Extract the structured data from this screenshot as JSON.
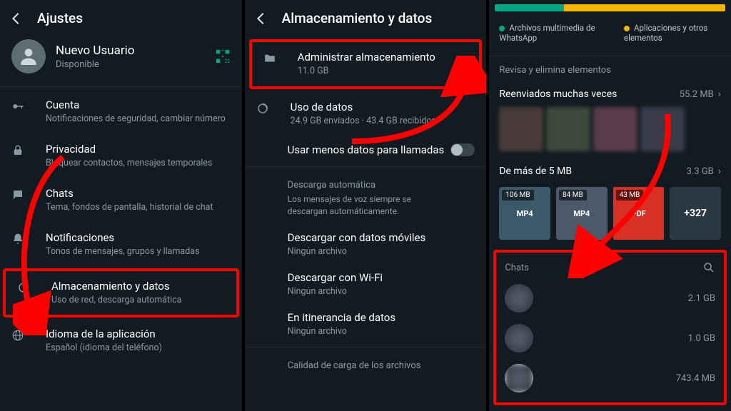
{
  "panel1": {
    "title": "Ajustes",
    "user": {
      "name": "Nuevo Usuario",
      "status": "Disponible"
    },
    "items": [
      {
        "label": "Cuenta",
        "sub": "Notificaciones de seguridad, cambiar número"
      },
      {
        "label": "Privacidad",
        "sub": "Bloquear contactos, mensajes temporales"
      },
      {
        "label": "Chats",
        "sub": "Tema, fondos de pantalla, historial de chat"
      },
      {
        "label": "Notificaciones",
        "sub": "Tonos de mensajes, grupos y llamadas"
      },
      {
        "label": "Almacenamiento y datos",
        "sub": "Uso de red, descarga automática"
      },
      {
        "label": "Idioma de la aplicación",
        "sub": "Español (idioma del teléfono)"
      }
    ]
  },
  "panel2": {
    "title": "Almacenamiento y datos",
    "manage": {
      "label": "Administrar almacenamiento",
      "sub": "11.0 GB"
    },
    "netuse": {
      "label": "Uso de datos",
      "sub": "24.9 GB enviados · 43.4 GB recibidos"
    },
    "lessdata": {
      "label": "Usar menos datos para llamadas"
    },
    "section_auto": "Descarga automática",
    "section_auto_sub": "Los mensajes de voz siempre se descargan automáticamente.",
    "dl": [
      {
        "label": "Descargar con datos móviles",
        "sub": "Ningún archivo"
      },
      {
        "label": "Descargar con Wi-Fi",
        "sub": "Ningún archivo"
      },
      {
        "label": "En itinerancia de datos",
        "sub": "Ningún archivo"
      }
    ],
    "quality_section": "Calidad de carga de los archivos"
  },
  "panel3": {
    "legend_media": "Archivos multimedia de WhatsApp",
    "legend_apps": "Aplicaciones y otros elementos",
    "review": "Revisa y elimina elementos",
    "forwarded": {
      "label": "Reenviados muchas veces",
      "size": "55.2 MB"
    },
    "over5": {
      "label": "De más de 5 MB",
      "size": "3.3 GB"
    },
    "tiles": [
      {
        "badge": "106 MB",
        "ft": "MP4"
      },
      {
        "badge": "84 MB",
        "ft": "MP4"
      },
      {
        "badge": "43 MB",
        "ft": "PDF"
      },
      {
        "badge": "+327",
        "ft": ""
      }
    ],
    "chats_label": "Chats",
    "chats": [
      {
        "size": "2.1 GB"
      },
      {
        "size": "1.0 GB"
      },
      {
        "size": "743.4 MB"
      }
    ]
  },
  "colors": {
    "green": "#00a884",
    "yellow": "#f7b500",
    "red": "#ff0000"
  }
}
